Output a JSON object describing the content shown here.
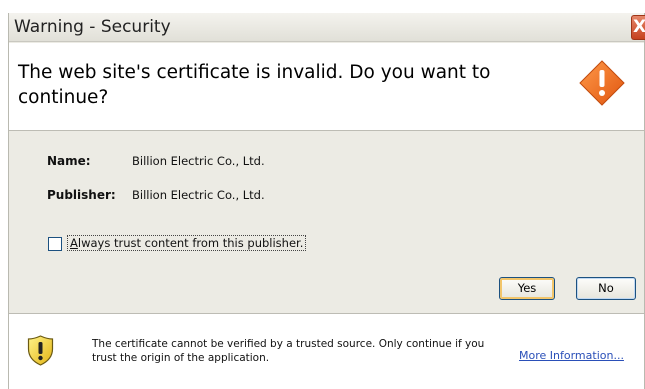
{
  "window": {
    "title": "Warning - Security",
    "close_glyph": "X"
  },
  "header": {
    "message": "The web site's certificate is invalid.  Do you want to continue?",
    "icon": "warning-diamond-icon"
  },
  "details": {
    "name_label": "Name:",
    "name_value": "Billion Electric Co., Ltd.",
    "publisher_label": "Publisher:",
    "publisher_value": "Billion Electric Co., Ltd."
  },
  "trust_checkbox": {
    "checked": false,
    "label_accel": "A",
    "label_rest": "lways trust content from this publisher."
  },
  "buttons": {
    "yes": "Yes",
    "no": "No"
  },
  "footer": {
    "icon": "shield-warning-icon",
    "message": "The certificate cannot be verified by a trusted source.  Only continue if you trust the origin of the application.",
    "link_accel": "M",
    "link_rest": "ore Information..."
  },
  "colors": {
    "accent_orange": "#f26d21",
    "shield_yellow": "#f7d33a",
    "link_blue": "#2a4fb8"
  }
}
